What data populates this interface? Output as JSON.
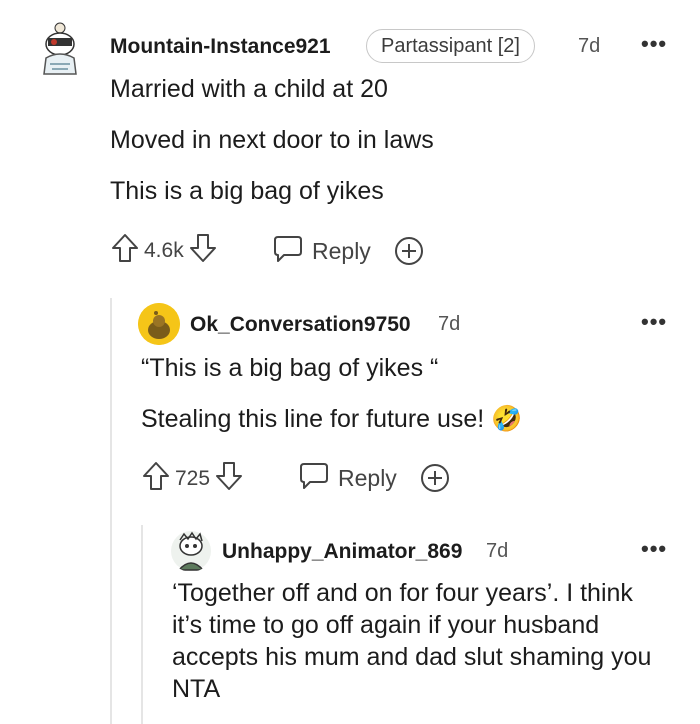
{
  "comments": [
    {
      "username": "Mountain-Instance921",
      "flair": "Partassipant [2]",
      "time": "7d",
      "lines": [
        "Married with a child at 20",
        "Moved in next door to in laws",
        "This is a big bag of yikes"
      ],
      "votes": "4.6k",
      "reply_label": "Reply",
      "avatar_icon": "snoo-avatar-icon"
    },
    {
      "username": "Ok_Conversation9750",
      "time": "7d",
      "lines": [
        "“This is a big bag of yikes “",
        "Stealing this line for future use! 🤣"
      ],
      "votes": "725",
      "reply_label": "Reply",
      "avatar_icon": "snoo-avatar-icon"
    },
    {
      "username": "Unhappy_Animator_869",
      "time": "7d",
      "text": "‘Together off and on for four years’. I think it’s time to go off again if your husband accepts his mum and dad slut shaming you NTA",
      "avatar_icon": "snoo-avatar-icon"
    }
  ],
  "more_label": "•••",
  "colors": {
    "text": "#1c1c1c",
    "meta": "#555555",
    "avatar_yellow": "#f5c518"
  }
}
